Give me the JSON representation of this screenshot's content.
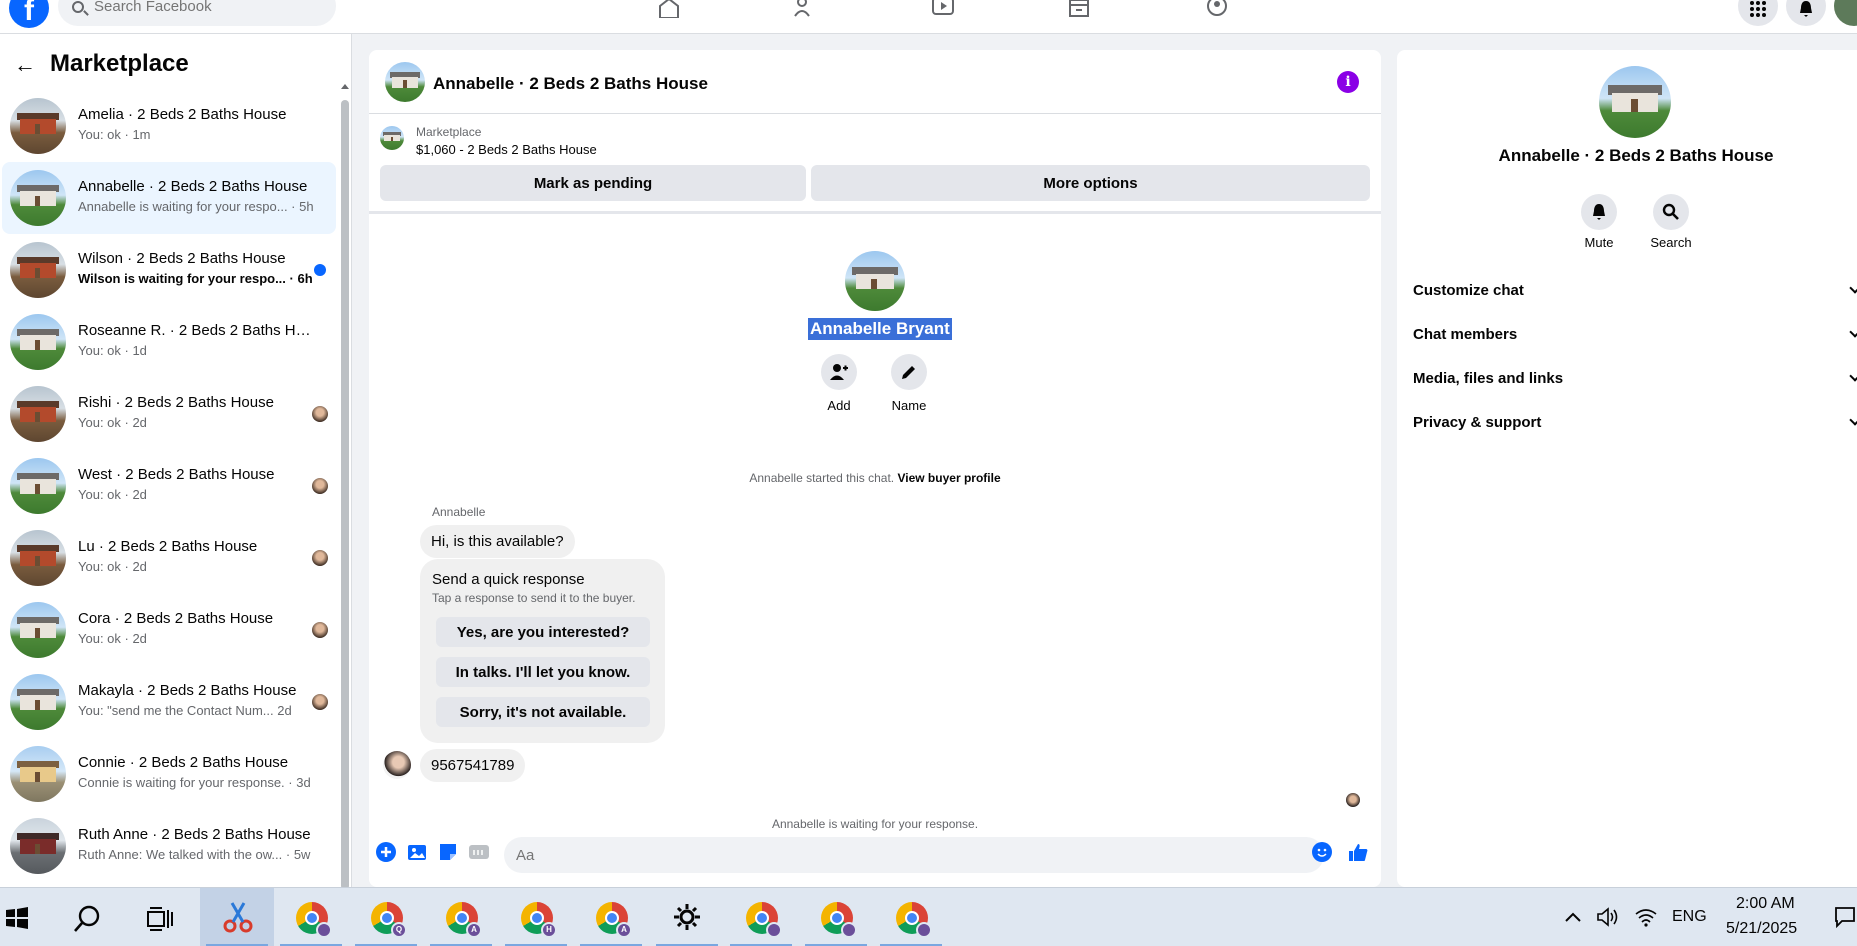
{
  "topbar": {
    "logo_letter": "f",
    "search_placeholder": "Search Facebook"
  },
  "sidebar": {
    "title": "Marketplace",
    "conversations": [
      {
        "title": "Amelia · 2 Beds 2 Baths House",
        "subtitle": "You: ok · 1m",
        "house": "red",
        "unread": false,
        "seen_avatar": false
      },
      {
        "title": "Annabelle · 2 Beds 2 Baths House",
        "subtitle": "Annabelle is waiting for your respo... · 5h",
        "house": "green",
        "unread": false,
        "seen_avatar": false,
        "active": true
      },
      {
        "title": "Wilson · 2 Beds 2 Baths House",
        "subtitle": "Wilson is waiting for your respo... · 6h",
        "house": "red",
        "unread": true,
        "seen_avatar": false
      },
      {
        "title": "Roseanne R. · 2 Beds 2 Baths Ho...",
        "subtitle": "You: ok · 1d",
        "house": "green",
        "unread": false,
        "seen_avatar": false
      },
      {
        "title": "Rishi · 2 Beds 2 Baths House",
        "subtitle": "You: ok · 2d",
        "house": "red",
        "unread": false,
        "seen_avatar": true
      },
      {
        "title": "West · 2 Beds 2 Baths House",
        "subtitle": "You: ok · 2d",
        "house": "green",
        "unread": false,
        "seen_avatar": true
      },
      {
        "title": "Lu · 2 Beds 2 Baths House",
        "subtitle": "You: ok · 2d",
        "house": "red",
        "unread": false,
        "seen_avatar": true
      },
      {
        "title": "Cora · 2 Beds 2 Baths House",
        "subtitle": "You: ok · 2d",
        "house": "green",
        "unread": false,
        "seen_avatar": true
      },
      {
        "title": "Makayla · 2 Beds 2 Baths House",
        "subtitle": "You: \"send me the Contact Num...   2d",
        "house": "green",
        "unread": false,
        "seen_avatar": true
      },
      {
        "title": "Connie · 2 Beds 2 Baths House",
        "subtitle": "Connie is waiting for your response. · 3d",
        "house": "yellow",
        "unread": false,
        "seen_avatar": false
      },
      {
        "title": "Ruth Anne · 2 Beds 2 Baths House",
        "subtitle": "Ruth Anne: We talked with the ow...  · 5w",
        "house": "dark",
        "unread": false,
        "seen_avatar": false
      }
    ]
  },
  "chat": {
    "header_title": "Annabelle · 2 Beds 2 Baths House",
    "info_glyph": "i",
    "listing_label": "Marketplace",
    "listing_price": "$1,060 - 2 Beds 2 Baths House",
    "mark_pending_label": "Mark as pending",
    "more_options_label": "More options",
    "buyer_name": "Annabelle Bryant",
    "add_label": "Add",
    "name_label": "Name",
    "started_text": "Annabelle started this chat.",
    "view_profile_label": "View buyer profile",
    "sender_label": "Annabelle",
    "first_message": "Hi, is this available?",
    "quick_title": "Send a quick response",
    "quick_subtitle": "Tap a response to send it to the buyer.",
    "quick_replies": [
      "Yes, are you interested?",
      "In talks. I'll let you know.",
      "Sorry, it's not available."
    ],
    "phone_message": "9567541789",
    "waiting_text": "Annabelle is waiting for your response.",
    "composer_placeholder": "Aa"
  },
  "details": {
    "name": "Annabelle · 2 Beds 2 Baths House",
    "mute_label": "Mute",
    "search_label": "Search",
    "sections": [
      "Customize chat",
      "Chat members",
      "Media, files and links",
      "Privacy & support"
    ]
  },
  "taskbar": {
    "language": "ENG",
    "time": "2:00 AM",
    "date": "5/21/2025",
    "chrome_badges": [
      "",
      "Q",
      "A",
      "H",
      "A",
      "",
      "",
      "",
      ""
    ]
  },
  "colors": {
    "facebook_blue": "#0866ff",
    "info_purple": "#8a00e6",
    "selection_blue": "#3a6fd8",
    "active_row": "#ebf5ff"
  }
}
